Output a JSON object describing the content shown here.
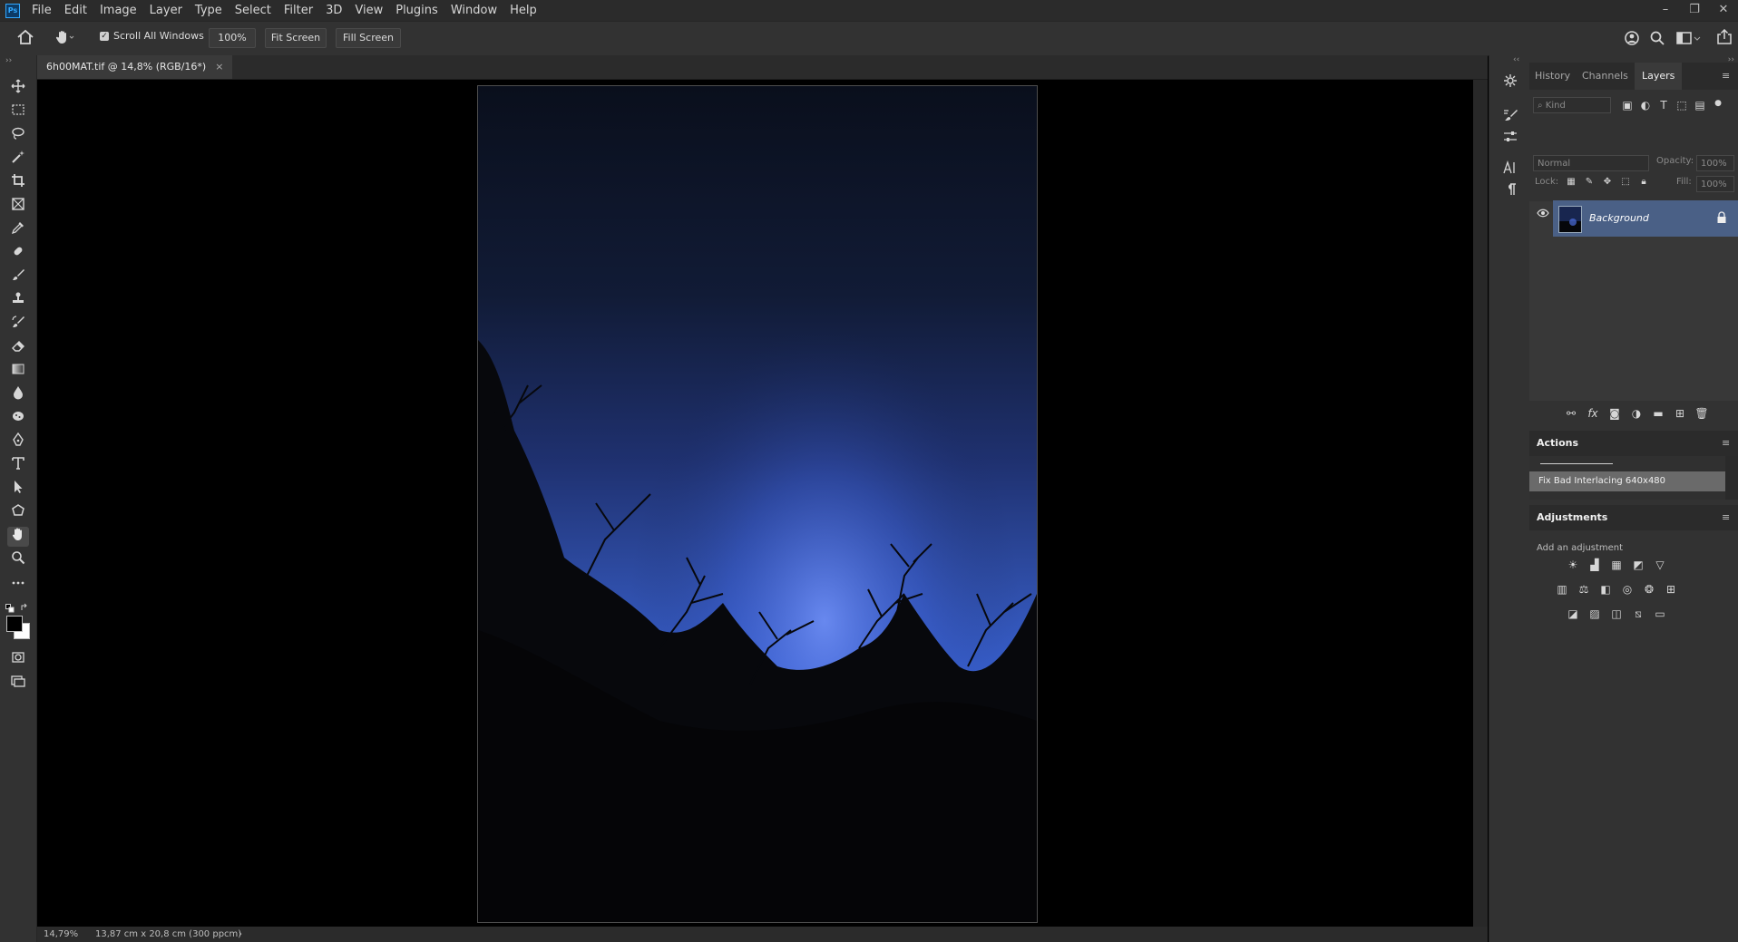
{
  "app": {
    "logo": "Ps"
  },
  "menu": [
    "File",
    "Edit",
    "Image",
    "Layer",
    "Type",
    "Select",
    "Filter",
    "3D",
    "View",
    "Plugins",
    "Window",
    "Help"
  ],
  "window_controls": [
    "–",
    "❐",
    "✕"
  ],
  "options": {
    "scroll_all_label": "Scroll All Windows",
    "scroll_all_checked": true,
    "zoom_button": "100%",
    "fit_button": "Fit Screen",
    "fill_button": "Fill Screen"
  },
  "document": {
    "tab_title": "6h00MAT.tif @ 14,8% (RGB/16*)",
    "close": "×"
  },
  "status": {
    "zoom": "14,79%",
    "doc_size": "13,87 cm x 20,8 cm (300 ppcm)",
    "arrow": "›"
  },
  "panels": {
    "tabs": [
      "History",
      "Channels",
      "Layers"
    ],
    "active_tab": "Layers",
    "filter_placeholder": "Kind",
    "blend_mode": "Normal",
    "opacity_label": "Opacity:",
    "opacity_value": "100%",
    "lock_label": "Lock:",
    "fill_label": "Fill:",
    "fill_value": "100%",
    "layers": [
      {
        "name": "Background",
        "visible": true,
        "locked": true
      }
    ],
    "actions_title": "Actions",
    "actions_set": "",
    "actions_item": "Fix Bad Interlacing 640x480",
    "adjustments_title": "Adjustments",
    "adjustments_hint": "Add an adjustment"
  },
  "colors": {
    "accent_layer": "#4a6086",
    "sky_top": "#0a0f1c",
    "sky_glow": "#3a64d8"
  }
}
